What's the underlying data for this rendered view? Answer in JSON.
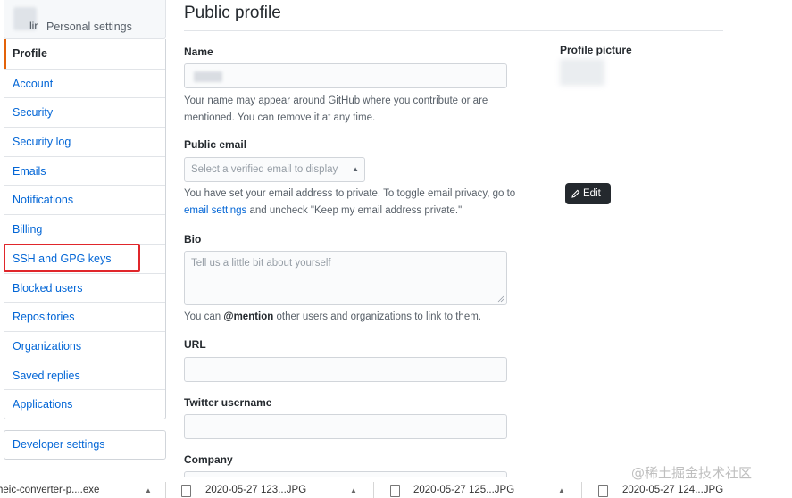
{
  "sidebar": {
    "user_prefix": "lir",
    "user_caption": "Personal settings",
    "items": [
      {
        "label": "Profile",
        "selected": true
      },
      {
        "label": "Account"
      },
      {
        "label": "Security"
      },
      {
        "label": "Security log"
      },
      {
        "label": "Emails"
      },
      {
        "label": "Notifications"
      },
      {
        "label": "Billing"
      },
      {
        "label": "SSH and GPG keys",
        "highlighted": true
      },
      {
        "label": "Blocked users"
      },
      {
        "label": "Repositories"
      },
      {
        "label": "Organizations"
      },
      {
        "label": "Saved replies"
      },
      {
        "label": "Applications"
      }
    ],
    "developer_settings": "Developer settings"
  },
  "main": {
    "title": "Public profile",
    "name": {
      "label": "Name",
      "note": "Your name may appear around GitHub where you contribute or are mentioned. You can remove it at any time."
    },
    "public_email": {
      "label": "Public email",
      "select_placeholder": "Select a verified email to display",
      "note_before": "You have set your email address to private. To toggle email privacy, go to",
      "note_link": "email settings",
      "note_after": "and uncheck \"Keep my email address private.\""
    },
    "bio": {
      "label": "Bio",
      "placeholder": "Tell us a little bit about yourself",
      "note_before": "You can",
      "note_mention": "@mention",
      "note_after": "other users and organizations to link to them."
    },
    "url": {
      "label": "URL",
      "value": ""
    },
    "twitter": {
      "label": "Twitter username",
      "value": ""
    },
    "company": {
      "label": "Company"
    }
  },
  "profile_picture": {
    "label": "Profile picture",
    "edit_label": "Edit"
  },
  "download_bar": {
    "first_file": "heic-converter-p....exe",
    "items": [
      "2020-05-27 123...JPG",
      "2020-05-27 125...JPG",
      "2020-05-27 124...JPG"
    ]
  },
  "watermark": "@稀土掘金技术社区",
  "colors": {
    "link": "#0366d6",
    "selected_marker": "#e36209",
    "highlight": "#e0262b",
    "button_dark": "#24292e"
  }
}
